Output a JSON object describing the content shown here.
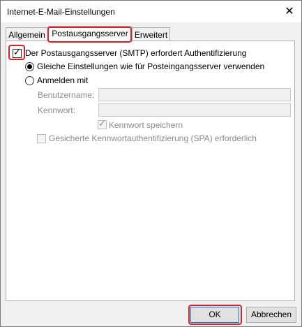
{
  "window": {
    "title": "Internet-E-Mail-Einstellungen",
    "close_glyph": "✕"
  },
  "tabs": [
    {
      "label": "Allgemein",
      "active": false
    },
    {
      "label": "Postausgangsserver",
      "active": true
    },
    {
      "label": "Erweitert",
      "active": false
    }
  ],
  "options": {
    "auth_required_label": "Der Postausgangsserver (SMTP) erfordert Authentifizierung",
    "auth_required_checked": true,
    "same_settings_label": "Gleiche Einstellungen wie für Posteingangsserver verwenden",
    "same_settings_selected": true,
    "login_with_label": "Anmelden mit",
    "login_with_selected": false,
    "username_label": "Benutzername:",
    "username_value": "",
    "password_label": "Kennwort:",
    "password_value": "",
    "save_password_label": "Kennwort speichern",
    "save_password_checked": true,
    "spa_label": "Gesicherte Kennwortauthentifizierung (SPA) erforderlich",
    "spa_checked": false
  },
  "buttons": {
    "ok": "OK",
    "cancel": "Abbrechen"
  },
  "colors": {
    "highlight": "#d4212a",
    "focus": "#0078d7"
  }
}
